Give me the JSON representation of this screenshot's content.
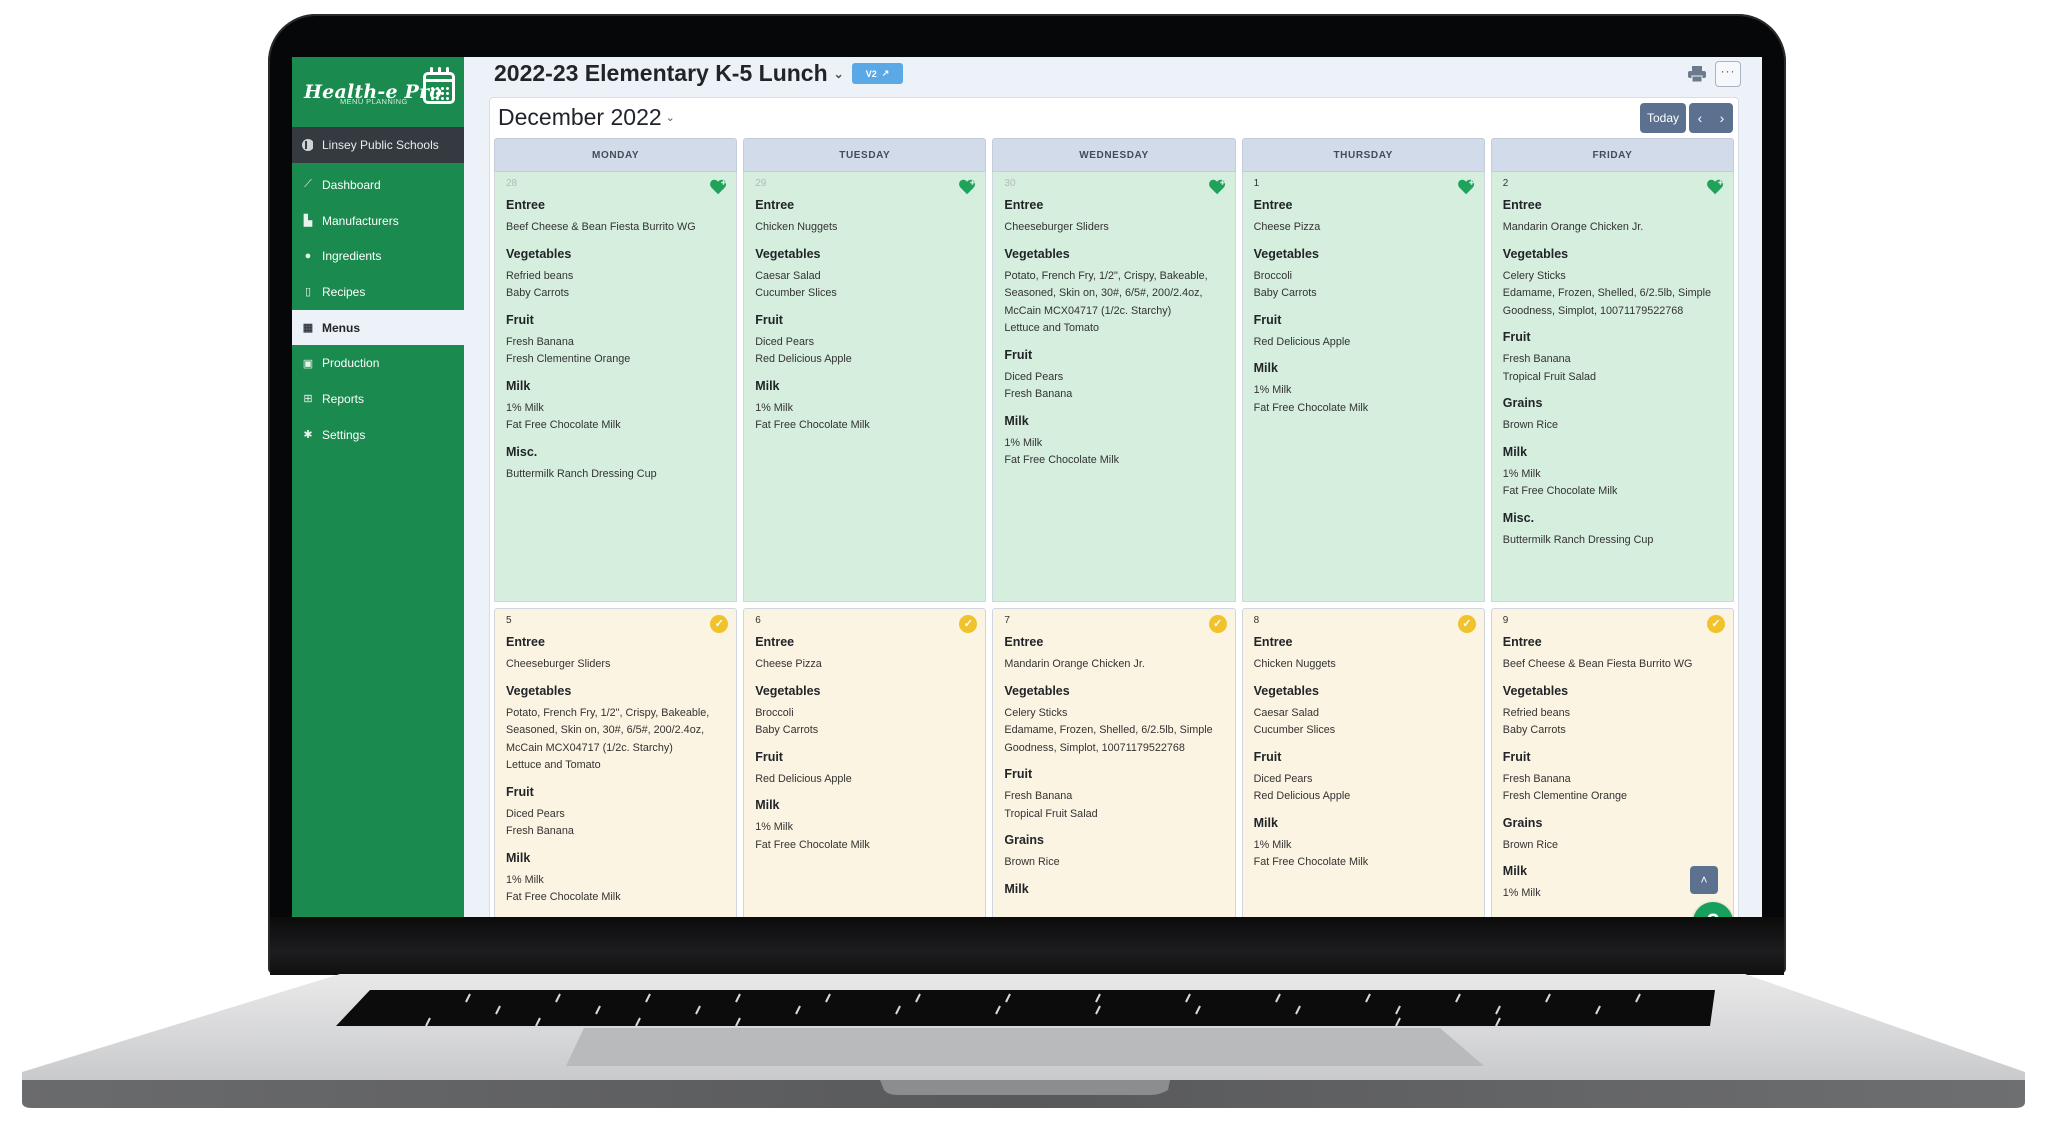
{
  "app": {
    "brand_name": "Health-e Pro",
    "brand_subtitle": "MENU PLANNING",
    "organization": "Linsey Public Schools"
  },
  "sidebar": {
    "items": [
      {
        "label": "Dashboard",
        "icon": "chart-line-icon",
        "active": false
      },
      {
        "label": "Manufacturers",
        "icon": "industry-icon",
        "active": false
      },
      {
        "label": "Ingredients",
        "icon": "apple-icon",
        "active": false
      },
      {
        "label": "Recipes",
        "icon": "file-icon",
        "active": false
      },
      {
        "label": "Menus",
        "icon": "calendar-icon",
        "active": true
      },
      {
        "label": "Production",
        "icon": "clipboard-check-icon",
        "active": false
      },
      {
        "label": "Reports",
        "icon": "table-icon",
        "active": false
      },
      {
        "label": "Settings",
        "icon": "gear-icon",
        "active": false
      }
    ]
  },
  "header": {
    "menu_title": "2022-23 Elementary K-5 Lunch",
    "version_badge": "V2",
    "print_icon": "print-icon",
    "more_label": "···"
  },
  "calendar": {
    "month_label": "December 2022",
    "today_label": "Today",
    "prev_label": "‹",
    "next_label": "›",
    "weekdays": [
      "MONDAY",
      "TUESDAY",
      "WEDNESDAY",
      "THURSDAY",
      "FRIDAY"
    ],
    "colors": {
      "planned_week": "#d6eedd",
      "approved_week": "#fcf4e2",
      "heart": "#1fa35a",
      "check": "#f0c22b"
    },
    "weeks": [
      {
        "status": "heart",
        "days": [
          {
            "date": "28",
            "other_month": true,
            "sections": [
              {
                "category": "Entree",
                "items": [
                  "Beef Cheese & Bean Fiesta Burrito WG"
                ]
              },
              {
                "category": "Vegetables",
                "items": [
                  "Refried beans",
                  "Baby Carrots"
                ]
              },
              {
                "category": "Fruit",
                "items": [
                  "Fresh Banana",
                  "Fresh Clementine Orange"
                ]
              },
              {
                "category": "Milk",
                "items": [
                  "1% Milk",
                  "Fat Free Chocolate Milk"
                ]
              },
              {
                "category": "Misc.",
                "items": [
                  "Buttermilk Ranch Dressing Cup"
                ]
              }
            ]
          },
          {
            "date": "29",
            "other_month": true,
            "sections": [
              {
                "category": "Entree",
                "items": [
                  "Chicken Nuggets"
                ]
              },
              {
                "category": "Vegetables",
                "items": [
                  "Caesar Salad",
                  "Cucumber Slices"
                ]
              },
              {
                "category": "Fruit",
                "items": [
                  "Diced Pears",
                  "Red Delicious Apple"
                ]
              },
              {
                "category": "Milk",
                "items": [
                  "1% Milk",
                  "Fat Free Chocolate Milk"
                ]
              }
            ]
          },
          {
            "date": "30",
            "other_month": true,
            "sections": [
              {
                "category": "Entree",
                "items": [
                  "Cheeseburger Sliders"
                ]
              },
              {
                "category": "Vegetables",
                "items": [
                  "Potato, French Fry, 1/2\", Crispy, Bakeable, Seasoned, Skin on, 30#, 6/5#, 200/2.4oz, McCain MCX04717 (1/2c. Starchy)",
                  "Lettuce and Tomato"
                ]
              },
              {
                "category": "Fruit",
                "items": [
                  "Diced Pears",
                  "Fresh Banana"
                ]
              },
              {
                "category": "Milk",
                "items": [
                  "1% Milk",
                  "Fat Free Chocolate Milk"
                ]
              }
            ]
          },
          {
            "date": "1",
            "other_month": false,
            "sections": [
              {
                "category": "Entree",
                "items": [
                  "Cheese Pizza"
                ]
              },
              {
                "category": "Vegetables",
                "items": [
                  "Broccoli",
                  "Baby Carrots"
                ]
              },
              {
                "category": "Fruit",
                "items": [
                  "Red Delicious Apple"
                ]
              },
              {
                "category": "Milk",
                "items": [
                  "1% Milk",
                  "Fat Free Chocolate Milk"
                ]
              }
            ]
          },
          {
            "date": "2",
            "other_month": false,
            "sections": [
              {
                "category": "Entree",
                "items": [
                  "Mandarin Orange Chicken Jr."
                ]
              },
              {
                "category": "Vegetables",
                "items": [
                  "Celery Sticks",
                  "Edamame, Frozen, Shelled, 6/2.5lb, Simple Goodness, Simplot, 10071179522768"
                ]
              },
              {
                "category": "Fruit",
                "items": [
                  "Fresh Banana",
                  "Tropical Fruit Salad"
                ]
              },
              {
                "category": "Grains",
                "items": [
                  "Brown Rice"
                ]
              },
              {
                "category": "Milk",
                "items": [
                  "1% Milk",
                  "Fat Free Chocolate Milk"
                ]
              },
              {
                "category": "Misc.",
                "items": [
                  "Buttermilk Ranch Dressing Cup"
                ]
              }
            ]
          }
        ]
      },
      {
        "status": "check",
        "days": [
          {
            "date": "5",
            "other_month": false,
            "sections": [
              {
                "category": "Entree",
                "items": [
                  "Cheeseburger Sliders"
                ]
              },
              {
                "category": "Vegetables",
                "items": [
                  "Potato, French Fry, 1/2\", Crispy, Bakeable, Seasoned, Skin on, 30#, 6/5#, 200/2.4oz, McCain MCX04717 (1/2c. Starchy)",
                  "Lettuce and Tomato"
                ]
              },
              {
                "category": "Fruit",
                "items": [
                  "Diced Pears",
                  "Fresh Banana"
                ]
              },
              {
                "category": "Milk",
                "items": [
                  "1% Milk",
                  "Fat Free Chocolate Milk"
                ]
              }
            ]
          },
          {
            "date": "6",
            "other_month": false,
            "sections": [
              {
                "category": "Entree",
                "items": [
                  "Cheese Pizza"
                ]
              },
              {
                "category": "Vegetables",
                "items": [
                  "Broccoli",
                  "Baby Carrots"
                ]
              },
              {
                "category": "Fruit",
                "items": [
                  "Red Delicious Apple"
                ]
              },
              {
                "category": "Milk",
                "items": [
                  "1% Milk",
                  "Fat Free Chocolate Milk"
                ]
              }
            ]
          },
          {
            "date": "7",
            "other_month": false,
            "sections": [
              {
                "category": "Entree",
                "items": [
                  "Mandarin Orange Chicken Jr."
                ]
              },
              {
                "category": "Vegetables",
                "items": [
                  "Celery Sticks",
                  "Edamame, Frozen, Shelled, 6/2.5lb, Simple Goodness, Simplot, 10071179522768"
                ]
              },
              {
                "category": "Fruit",
                "items": [
                  "Fresh Banana",
                  "Tropical Fruit Salad"
                ]
              },
              {
                "category": "Grains",
                "items": [
                  "Brown Rice"
                ]
              },
              {
                "category": "Milk",
                "items": []
              }
            ]
          },
          {
            "date": "8",
            "other_month": false,
            "sections": [
              {
                "category": "Entree",
                "items": [
                  "Chicken Nuggets"
                ]
              },
              {
                "category": "Vegetables",
                "items": [
                  "Caesar Salad",
                  "Cucumber Slices"
                ]
              },
              {
                "category": "Fruit",
                "items": [
                  "Diced Pears",
                  "Red Delicious Apple"
                ]
              },
              {
                "category": "Milk",
                "items": [
                  "1% Milk",
                  "Fat Free Chocolate Milk"
                ]
              }
            ]
          },
          {
            "date": "9",
            "other_month": false,
            "sections": [
              {
                "category": "Entree",
                "items": [
                  "Beef Cheese & Bean Fiesta Burrito WG"
                ]
              },
              {
                "category": "Vegetables",
                "items": [
                  "Refried beans",
                  "Baby Carrots"
                ]
              },
              {
                "category": "Fruit",
                "items": [
                  "Fresh Banana",
                  "Fresh Clementine Orange"
                ]
              },
              {
                "category": "Grains",
                "items": [
                  "Brown Rice"
                ]
              },
              {
                "category": "Milk",
                "items": [
                  "1% Milk"
                ]
              }
            ]
          }
        ]
      }
    ]
  },
  "floating": {
    "scroll_top_label": "˄",
    "help_label": "?"
  }
}
